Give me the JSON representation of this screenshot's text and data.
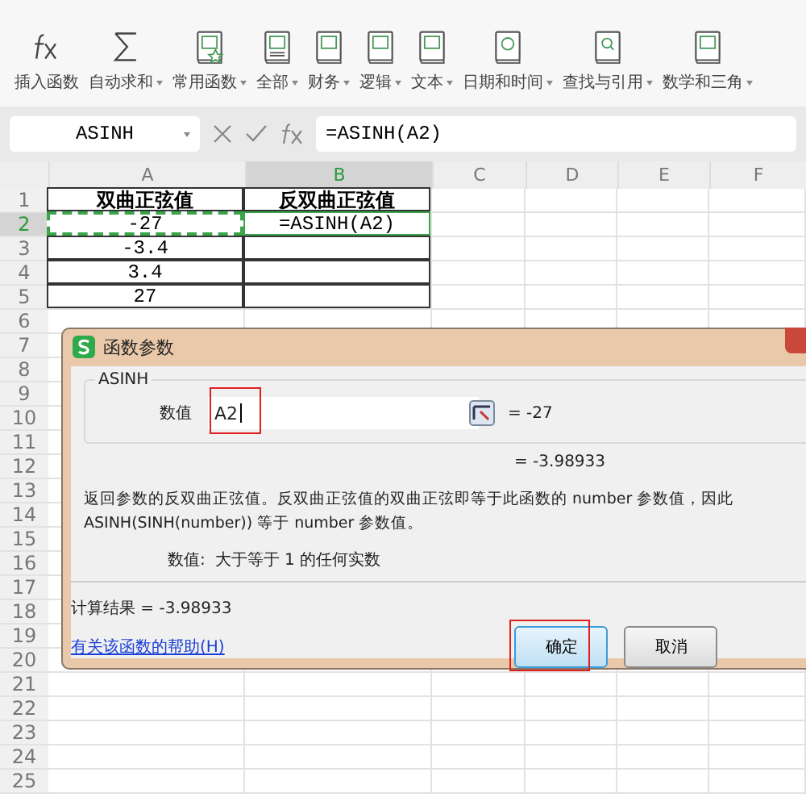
{
  "ribbon": [
    {
      "label": "插入函数",
      "has_menu": false
    },
    {
      "label": "自动求和",
      "has_menu": true
    },
    {
      "label": "常用函数",
      "has_menu": true
    },
    {
      "label": "全部",
      "has_menu": true
    },
    {
      "label": "财务",
      "has_menu": true
    },
    {
      "label": "逻辑",
      "has_menu": true
    },
    {
      "label": "文本",
      "has_menu": true
    },
    {
      "label": "日期和时间",
      "has_menu": true
    },
    {
      "label": "查找与引用",
      "has_menu": true
    },
    {
      "label": "数学和三角",
      "has_menu": true
    }
  ],
  "name_box": "ASINH",
  "formula": "=ASINH(A2)",
  "columns": [
    {
      "label": "A",
      "selected": false
    },
    {
      "label": "B",
      "selected": true
    },
    {
      "label": "C",
      "selected": false
    },
    {
      "label": "D",
      "selected": false
    },
    {
      "label": "E",
      "selected": false
    },
    {
      "label": "F",
      "selected": false
    }
  ],
  "row_headers": [
    {
      "label": "1",
      "selected": false
    },
    {
      "label": "2",
      "selected": true
    },
    {
      "label": "3",
      "selected": false
    },
    {
      "label": "4",
      "selected": false
    },
    {
      "label": "5",
      "selected": false
    },
    {
      "label": "6",
      "selected": false
    },
    {
      "label": "7",
      "selected": false
    },
    {
      "label": "8",
      "selected": false
    },
    {
      "label": "9",
      "selected": false
    },
    {
      "label": "10",
      "selected": false
    },
    {
      "label": "11",
      "selected": false
    },
    {
      "label": "12",
      "selected": false
    },
    {
      "label": "13",
      "selected": false
    },
    {
      "label": "14",
      "selected": false
    },
    {
      "label": "15",
      "selected": false
    },
    {
      "label": "16",
      "selected": false
    },
    {
      "label": "17",
      "selected": false
    },
    {
      "label": "18",
      "selected": false
    },
    {
      "label": "19",
      "selected": false
    },
    {
      "label": "20",
      "selected": false
    },
    {
      "label": "21",
      "selected": false
    },
    {
      "label": "22",
      "selected": false
    },
    {
      "label": "23",
      "selected": false
    },
    {
      "label": "24",
      "selected": false
    },
    {
      "label": "25",
      "selected": false
    }
  ],
  "table": [
    [
      {
        "text": "双曲正弦值",
        "kind": "header"
      },
      {
        "text": "反双曲正弦值",
        "kind": "header"
      }
    ],
    [
      {
        "text": "-27",
        "kind": "reference"
      },
      {
        "text": "=ASINH(A2)",
        "kind": "active"
      }
    ],
    [
      {
        "text": "-3.4",
        "kind": "normal"
      },
      {
        "kind": "normal"
      }
    ],
    [
      {
        "text": "3.4",
        "kind": "normal"
      },
      {
        "kind": "normal"
      }
    ],
    [
      {
        "text": "27",
        "kind": "normal"
      },
      {
        "kind": "normal"
      }
    ]
  ],
  "dialog": {
    "title": "函数参数",
    "function": "ASINH",
    "argument_label": "数值",
    "argument_value": "A2",
    "argument_result": "= -27",
    "formula_result": "= -3.98933",
    "description": "返回参数的反双曲正弦值。反双曲正弦值的双曲正弦即等于此函数的 number 参数值，因此 ASINH(SINH(number)) 等于 number 参数值。",
    "argument_help_label": "数值:",
    "argument_help": "大于等于 1 的任何实数",
    "calc_result": "计算结果 =  -3.98933",
    "help_link": "有关该函数的帮助(H)",
    "buttons": [
      {
        "label": "确定",
        "kind": "primary",
        "highlighted": true
      },
      {
        "label": "取消",
        "kind": "secondary",
        "highlighted": false
      }
    ],
    "input_highlighted": true
  }
}
